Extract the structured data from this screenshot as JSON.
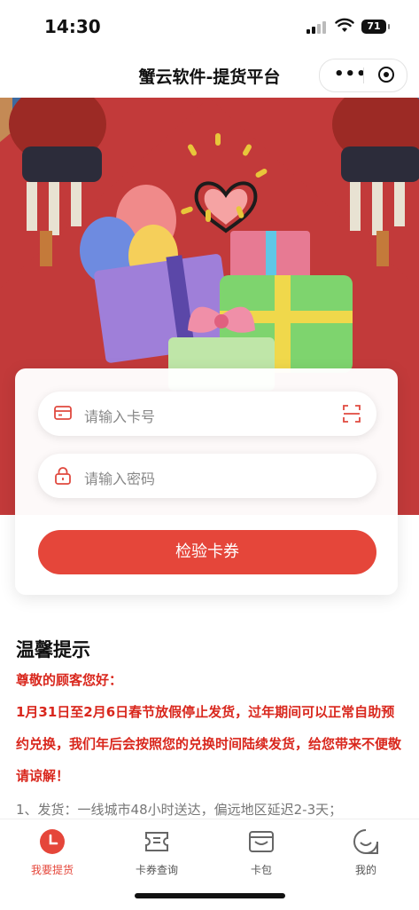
{
  "status": {
    "time": "14:30",
    "battery": "71"
  },
  "nav": {
    "title": "蟹云软件-提货平台"
  },
  "form": {
    "card_placeholder": "请输入卡号",
    "password_placeholder": "请输入密码",
    "verify_label": "检验卡券"
  },
  "tips": {
    "title": "温馨提示",
    "greeting": "尊敬的顾客您好：",
    "notice": "1月31日至2月6日春节放假停止发货，过年期间可以正常自助预约兑换，我们年后会按照您的兑换时间陆续发货，给您带来不便敬请谅解！",
    "line1": "1、发货：一线城市48小时送达，偏远地区延迟2-3天；"
  },
  "tabs": [
    {
      "label": "我要提货",
      "icon": "clock-icon",
      "active": true
    },
    {
      "label": "卡券查询",
      "icon": "coupon-icon",
      "active": false
    },
    {
      "label": "卡包",
      "icon": "wallet-icon",
      "active": false
    },
    {
      "label": "我的",
      "icon": "smile-chat-icon",
      "active": false
    }
  ],
  "colors": {
    "accent": "#e5463a",
    "notice_red": "#d9271d",
    "banner_red": "#c23a3a",
    "banner_blue": "#3d6aa0"
  }
}
